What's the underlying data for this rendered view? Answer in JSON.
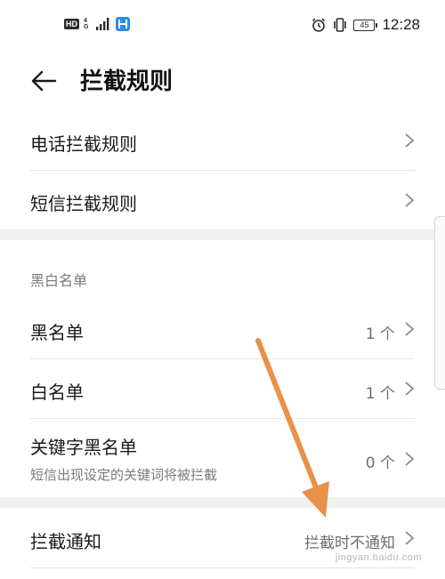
{
  "status_bar": {
    "hd_badge": "HD",
    "network": "4G",
    "time": "12:28",
    "battery": "45"
  },
  "header": {
    "title": "拦截规则"
  },
  "rules": [
    {
      "title": "电话拦截规则"
    },
    {
      "title": "短信拦截规则"
    }
  ],
  "blackwhite": {
    "section_label": "黑白名单",
    "items": [
      {
        "title": "黑名单",
        "value": "1 个"
      },
      {
        "title": "白名单",
        "value": "1 个"
      },
      {
        "title": "关键字黑名单",
        "subtitle": "短信出现设定的关键词将被拦截",
        "value": "0 个"
      }
    ]
  },
  "notify": {
    "title": "拦截通知",
    "value": "拦截时不通知"
  },
  "watermark": "jingyan.baidu.com",
  "colors": {
    "annotation_arrow": "#e8914a",
    "page_background": "#f1f1f1",
    "card_background": "#ffffff"
  }
}
